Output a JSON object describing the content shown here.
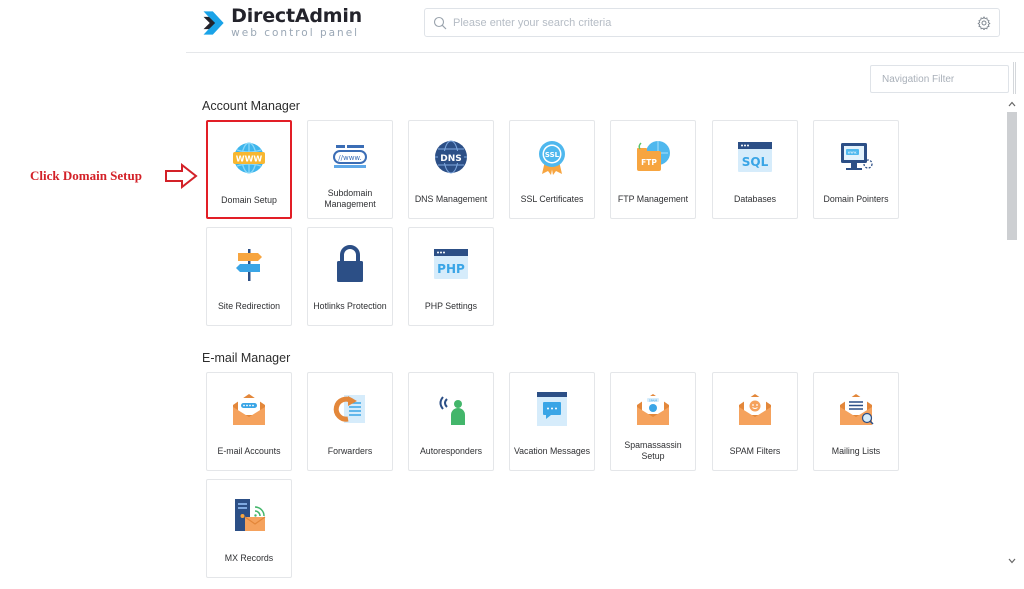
{
  "header": {
    "logo_title": "DirectAdmin",
    "logo_subtitle": "web control panel",
    "search_placeholder": "Please enter your search criteria",
    "icons": [
      "search-icon",
      "gear-icon"
    ]
  },
  "nav_filter": {
    "placeholder": "Navigation Filter"
  },
  "annotation": {
    "text": "Click Domain Setup",
    "color": "#d32128",
    "highlight_color": "#e21e26"
  },
  "sections": {
    "account_manager": {
      "title": "Account Manager",
      "items": [
        {
          "label": "Domain Setup",
          "icon": "globe-www-icon"
        },
        {
          "label": "Subdomain Management",
          "icon": "subdomain-icon"
        },
        {
          "label": "DNS Management",
          "icon": "dns-globe-icon"
        },
        {
          "label": "SSL Certificates",
          "icon": "ssl-badge-icon"
        },
        {
          "label": "FTP Management",
          "icon": "ftp-folder-icon"
        },
        {
          "label": "Databases",
          "icon": "sql-window-icon"
        },
        {
          "label": "Domain Pointers",
          "icon": "domain-pointer-monitor-icon"
        },
        {
          "label": "Site Redirection",
          "icon": "signpost-icon"
        },
        {
          "label": "Hotlinks Protection",
          "icon": "padlock-icon"
        },
        {
          "label": "PHP Settings",
          "icon": "php-window-icon"
        }
      ]
    },
    "email_manager": {
      "title": "E-mail Manager",
      "items": [
        {
          "label": "E-mail Accounts",
          "icon": "envelope-icon"
        },
        {
          "label": "Forwarders",
          "icon": "forward-document-icon"
        },
        {
          "label": "Autoresponders",
          "icon": "autoresponder-person-icon"
        },
        {
          "label": "Vacation Messages",
          "icon": "vacation-message-icon"
        },
        {
          "label": "Spamassassin Setup",
          "icon": "spam-envelope-icon"
        },
        {
          "label": "SPAM Filters",
          "icon": "spam-filter-envelope-icon"
        },
        {
          "label": "Mailing Lists",
          "icon": "mailing-list-envelope-icon"
        },
        {
          "label": "MX Records",
          "icon": "mx-server-icon"
        }
      ]
    }
  },
  "colors": {
    "brand_blue": "#1aa3e8",
    "brand_dark": "#23232b",
    "tile_border": "#e4e6e9",
    "envelope_orange": "#f5a25d",
    "accent_blue": "#3b6db5"
  }
}
